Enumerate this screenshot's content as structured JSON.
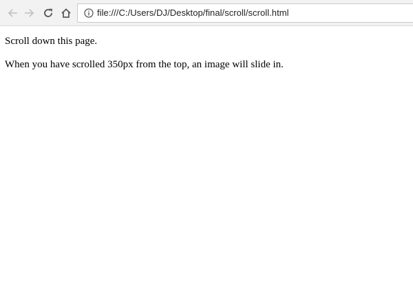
{
  "toolbar": {
    "back_icon": "arrow-left-icon",
    "forward_icon": "arrow-right-icon",
    "reload_icon": "reload-icon",
    "home_icon": "home-icon",
    "address_bar": {
      "site_info_icon": "info-icon",
      "url": "file:///C:/Users/DJ/Desktop/final/scroll/scroll.html"
    }
  },
  "page": {
    "paragraph_1": "Scroll down this page.",
    "paragraph_2": "When you have scrolled 350px from the top, an image will slide in."
  },
  "colors": {
    "toolbar_bg": "#f2f2f2",
    "icon_disabled": "#c4c4c4",
    "icon_active": "#5a5a5a",
    "page_bg": "#ffffff",
    "text": "#000000"
  }
}
